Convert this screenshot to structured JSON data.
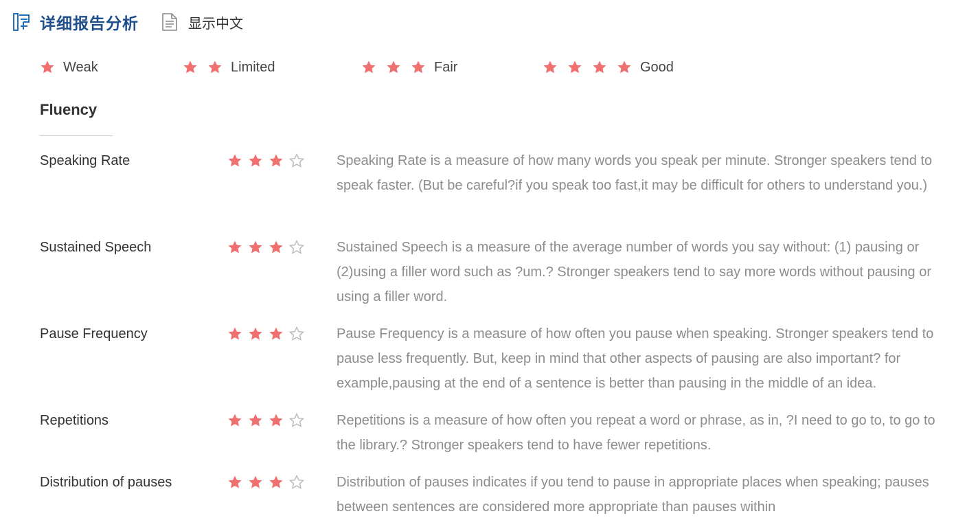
{
  "header": {
    "icon": "report-icon",
    "title": "详细报告分析",
    "toggle_icon": "document-icon",
    "toggle_label": "显示中文"
  },
  "colors": {
    "star_filled": "#f07070",
    "star_empty": "#b9b9b9",
    "title_blue": "#1f4e8c"
  },
  "legend": [
    {
      "stars": 1,
      "label": "Weak"
    },
    {
      "stars": 2,
      "label": "Limited"
    },
    {
      "stars": 3,
      "label": "Fair"
    },
    {
      "stars": 4,
      "label": "Good"
    }
  ],
  "section": {
    "title": "Fluency",
    "metrics": [
      {
        "name": "Speaking Rate",
        "rating": 3,
        "max": 4,
        "description": "Speaking Rate is a measure of how many words you speak per minute. Stronger speakers tend to speak faster. (But be careful?if you speak too fast,it may be difficult for others to understand you.)"
      },
      {
        "name": "Sustained Speech",
        "rating": 3,
        "max": 4,
        "description": "Sustained Speech is a measure of the average number of words you say without: (1) pausing or (2)using a filler word such as ?um.? Stronger speakers tend to say more words without pausing or using a filler word."
      },
      {
        "name": "Pause Frequency",
        "rating": 3,
        "max": 4,
        "description": "Pause Frequency is a measure of how often you pause when speaking. Stronger speakers tend to pause less frequently. But, keep in mind that other aspects of pausing are also important? for example,pausing at the end of a sentence is better than pausing in the middle of an idea."
      },
      {
        "name": "Repetitions",
        "rating": 3,
        "max": 4,
        "description": "Repetitions is a measure of how often you repeat a word or phrase, as in, ?I need to go to, to go to the library.? Stronger speakers tend to have fewer repetitions."
      },
      {
        "name": "Distribution of pauses",
        "rating": 3,
        "max": 4,
        "description": "Distribution of pauses indicates if you tend to pause in appropriate places when speaking; pauses between sentences are considered more appropriate than pauses within"
      }
    ]
  }
}
